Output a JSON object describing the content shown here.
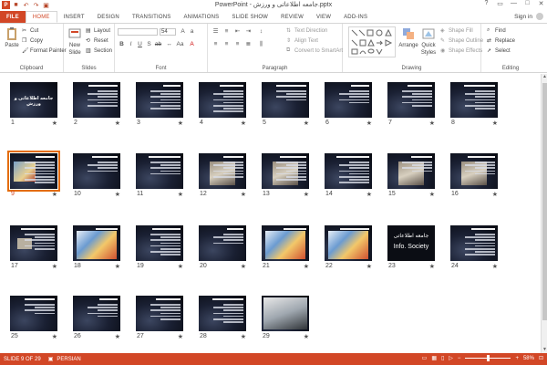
{
  "window": {
    "title": "PowerPoint - جامعه اطلاعاتی و ورزش.pptx",
    "app_icon": "P",
    "controls": [
      "?",
      "▭",
      "—",
      "□",
      "✕"
    ]
  },
  "quick_access": [
    "save",
    "undo",
    "redo",
    "start"
  ],
  "tabs": [
    "FILE",
    "HOME",
    "INSERT",
    "DESIGN",
    "TRANSITIONS",
    "ANIMATIONS",
    "SLIDE SHOW",
    "REVIEW",
    "VIEW",
    "ADD-INS"
  ],
  "active_tab": "HOME",
  "signin": "Sign in",
  "ribbon": {
    "clipboard": {
      "label": "Clipboard",
      "paste": "Paste",
      "cut": "Cut",
      "copy": "Copy",
      "format_painter": "Format Painter"
    },
    "slides": {
      "label": "Slides",
      "new_slide": "New",
      "new_slide2": "Slide",
      "layout": "Layout",
      "reset": "Reset",
      "section": "Section"
    },
    "font": {
      "label": "Font",
      "size": "54"
    },
    "paragraph": {
      "label": "Paragraph",
      "text_direction": "Text Direction",
      "align_text": "Align Text",
      "convert_smartart": "Convert to SmartArt"
    },
    "drawing": {
      "label": "Drawing",
      "arrange": "Arrange",
      "quick_styles": "Quick",
      "quick_styles2": "Styles",
      "shape_fill": "Shape Fill",
      "shape_outline": "Shape Outline",
      "shape_effects": "Shape Effects"
    },
    "editing": {
      "label": "Editing",
      "find": "Find",
      "replace": "Replace",
      "select": "Select"
    }
  },
  "slides": [
    {
      "n": "1"
    },
    {
      "n": "2"
    },
    {
      "n": "3"
    },
    {
      "n": "4"
    },
    {
      "n": "5"
    },
    {
      "n": "6"
    },
    {
      "n": "7"
    },
    {
      "n": "8"
    },
    {
      "n": "9"
    },
    {
      "n": "10"
    },
    {
      "n": "11"
    },
    {
      "n": "12"
    },
    {
      "n": "13"
    },
    {
      "n": "14"
    },
    {
      "n": "15"
    },
    {
      "n": "16"
    },
    {
      "n": "17"
    },
    {
      "n": "18"
    },
    {
      "n": "19"
    },
    {
      "n": "20"
    },
    {
      "n": "21"
    },
    {
      "n": "22"
    },
    {
      "n": "23"
    },
    {
      "n": "24"
    },
    {
      "n": "25"
    },
    {
      "n": "26"
    },
    {
      "n": "27"
    },
    {
      "n": "28"
    },
    {
      "n": "29"
    }
  ],
  "slide_texts": {
    "s1_title": "جامعه اطلاعاتی و ورزش",
    "s23_title": "جامعه اطلاعاتی",
    "s23_sub": "Info. Society"
  },
  "star_glyph": "★",
  "selected_slide": "9",
  "status": {
    "slide_info": "SLIDE 9 OF 29",
    "language": "PERSIAN",
    "zoom": "58%"
  },
  "colors": {
    "accent": "#d24726",
    "selection": "#e46c0a"
  }
}
